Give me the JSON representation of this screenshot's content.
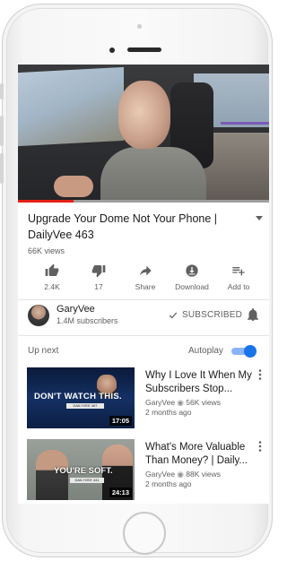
{
  "player": {
    "progress_fraction": 0.22,
    "accent": "#e62117"
  },
  "video": {
    "title": "Upgrade Your Dome Not Your Phone | DailyVee 463",
    "views": "66K views"
  },
  "actions": [
    {
      "icon": "thumbs-up-icon",
      "label": "2.4K"
    },
    {
      "icon": "thumbs-down-icon",
      "label": "17"
    },
    {
      "icon": "share-icon",
      "label": "Share"
    },
    {
      "icon": "download-icon",
      "label": "Download"
    },
    {
      "icon": "add-to-playlist-icon",
      "label": "Add to"
    }
  ],
  "channel": {
    "name": "GaryVee",
    "subscribers": "1.4M subscribers",
    "subscribed_label": "SUBSCRIBED"
  },
  "up_next": {
    "heading": "Up next",
    "autoplay_label": "Autoplay",
    "autoplay_on": true,
    "toggle_color": "#1a73e8",
    "items": [
      {
        "title": "Why I Love It When My Subscribers Stop...",
        "channel": "GaryVee",
        "views": "56K views",
        "age": "2 months ago",
        "duration": "17:05",
        "thumb_text": "DON'T WATCH THIS.",
        "thumb_tag": "DAILYVEE 467"
      },
      {
        "title": "What's More Valuable Than Money? | Daily...",
        "channel": "GaryVee",
        "views": "88K views",
        "age": "2 months ago",
        "duration": "24:13",
        "thumb_text": "YOU'RE SOFT.",
        "thumb_tag": "DAILYVEE 441"
      }
    ]
  }
}
